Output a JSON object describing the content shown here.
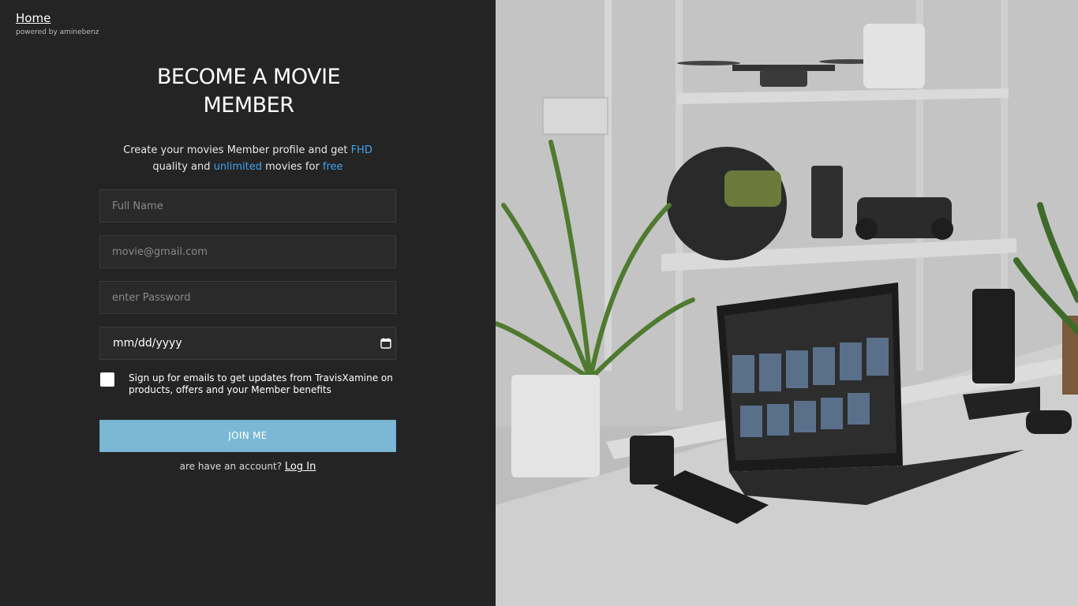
{
  "header": {
    "home_link": "Home",
    "powered_by": "powered by aminebenz"
  },
  "form": {
    "title_line1": "BECOME A MOVIE",
    "title_line2": "MEMBER",
    "subtitle": {
      "part1": "Create your movies Member profile and get ",
      "highlight1": "FHD",
      "part2": "quality and ",
      "highlight2": "unlimited",
      "part3": " movies for ",
      "highlight3": "free"
    },
    "full_name_placeholder": "Full Name",
    "email_placeholder": "movie@gmail.com",
    "password_placeholder": "enter Password",
    "date_placeholder": "mm/dd/yyyy",
    "newsletter_label": "Sign up for emails to get updates from TravisXamine on products, offers and your Member benefits",
    "newsletter_checked": false,
    "join_button": "JOIN ME",
    "account_prompt": "are have an account?",
    "login_link": "Log In"
  },
  "colors": {
    "panel_bg": "#242424",
    "accent": "#3ea3f0",
    "button_bg": "#7ab8d6"
  },
  "icons": {
    "date_picker": "calendar-icon"
  }
}
